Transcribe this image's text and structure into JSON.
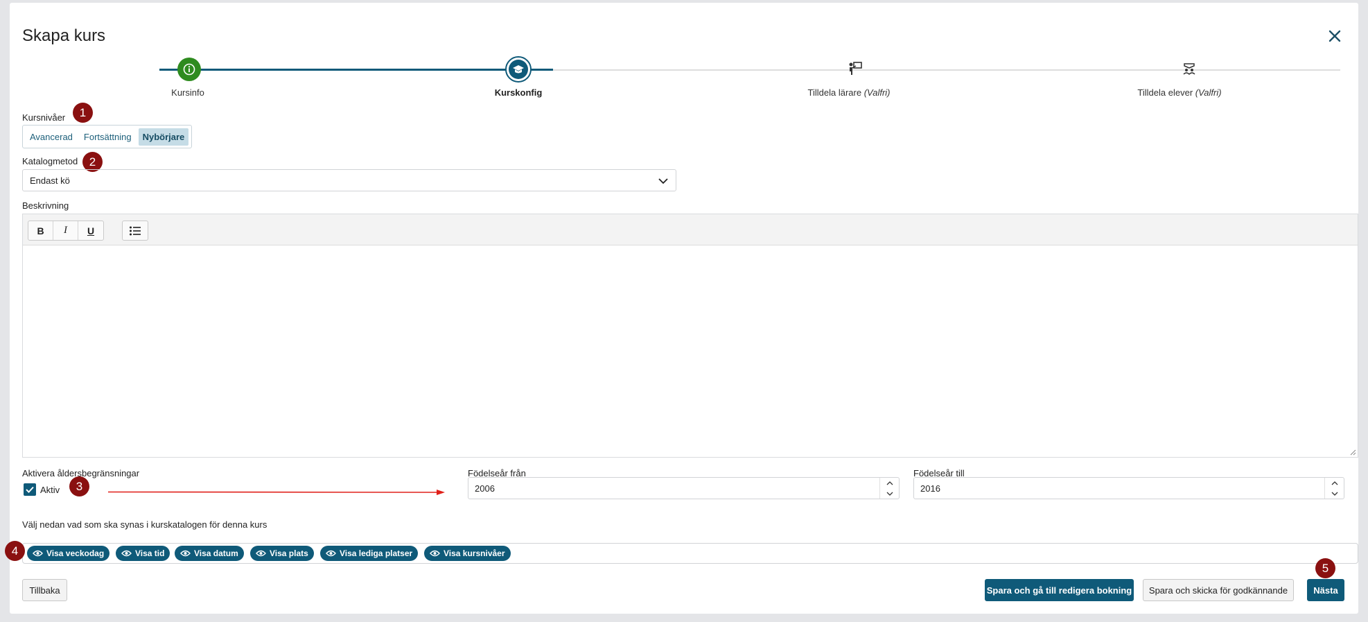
{
  "dialog": {
    "title": "Skapa kurs"
  },
  "stepper": {
    "steps": [
      {
        "label": "Kursinfo",
        "optional": ""
      },
      {
        "label": "Kurskonfig",
        "optional": ""
      },
      {
        "label": "Tilldela lärare",
        "optional": "(Valfri)"
      },
      {
        "label": "Tilldela elever",
        "optional": "(Valfri)"
      }
    ],
    "icons": [
      "info-icon",
      "course-icon",
      "teacher-icon",
      "students-icon"
    ],
    "colors": {
      "done": "#2e8b1f",
      "active": "#0f5a79",
      "pending": "#dddddd"
    }
  },
  "levels": {
    "label": "Kursnivåer",
    "options": [
      "Avancerad",
      "Fortsättning",
      "Nybörjare"
    ],
    "selected": "Nybörjare"
  },
  "catalog": {
    "label": "Katalogmetod",
    "value": "Endast kö"
  },
  "description": {
    "label": "Beskrivning",
    "toolbar": [
      "B",
      "I",
      "U"
    ],
    "value": ""
  },
  "age": {
    "label": "Aktivera åldersbegränsningar",
    "checkbox_label": "Aktiv",
    "checked": true,
    "from_label": "Födelseår från",
    "from_value": "2006",
    "to_label": "Födelseår till",
    "to_value": "2016"
  },
  "visibility": {
    "label": "Välj nedan vad som ska synas i kurskatalogen för denna kurs",
    "chips": [
      "Visa veckodag",
      "Visa tid",
      "Visa datum",
      "Visa plats",
      "Visa lediga platser",
      "Visa kursnivåer"
    ]
  },
  "annotations": [
    "1",
    "2",
    "3",
    "4",
    "5"
  ],
  "buttons": {
    "back": "Tillbaka",
    "save_edit": "Spara och gå till redigera bokning",
    "save_submit": "Spara och skicka för godkännande",
    "next": "Nästa"
  },
  "colors": {
    "accent": "#0f5a79",
    "annotation": "#8a1010",
    "arrow": "#e0201a"
  }
}
